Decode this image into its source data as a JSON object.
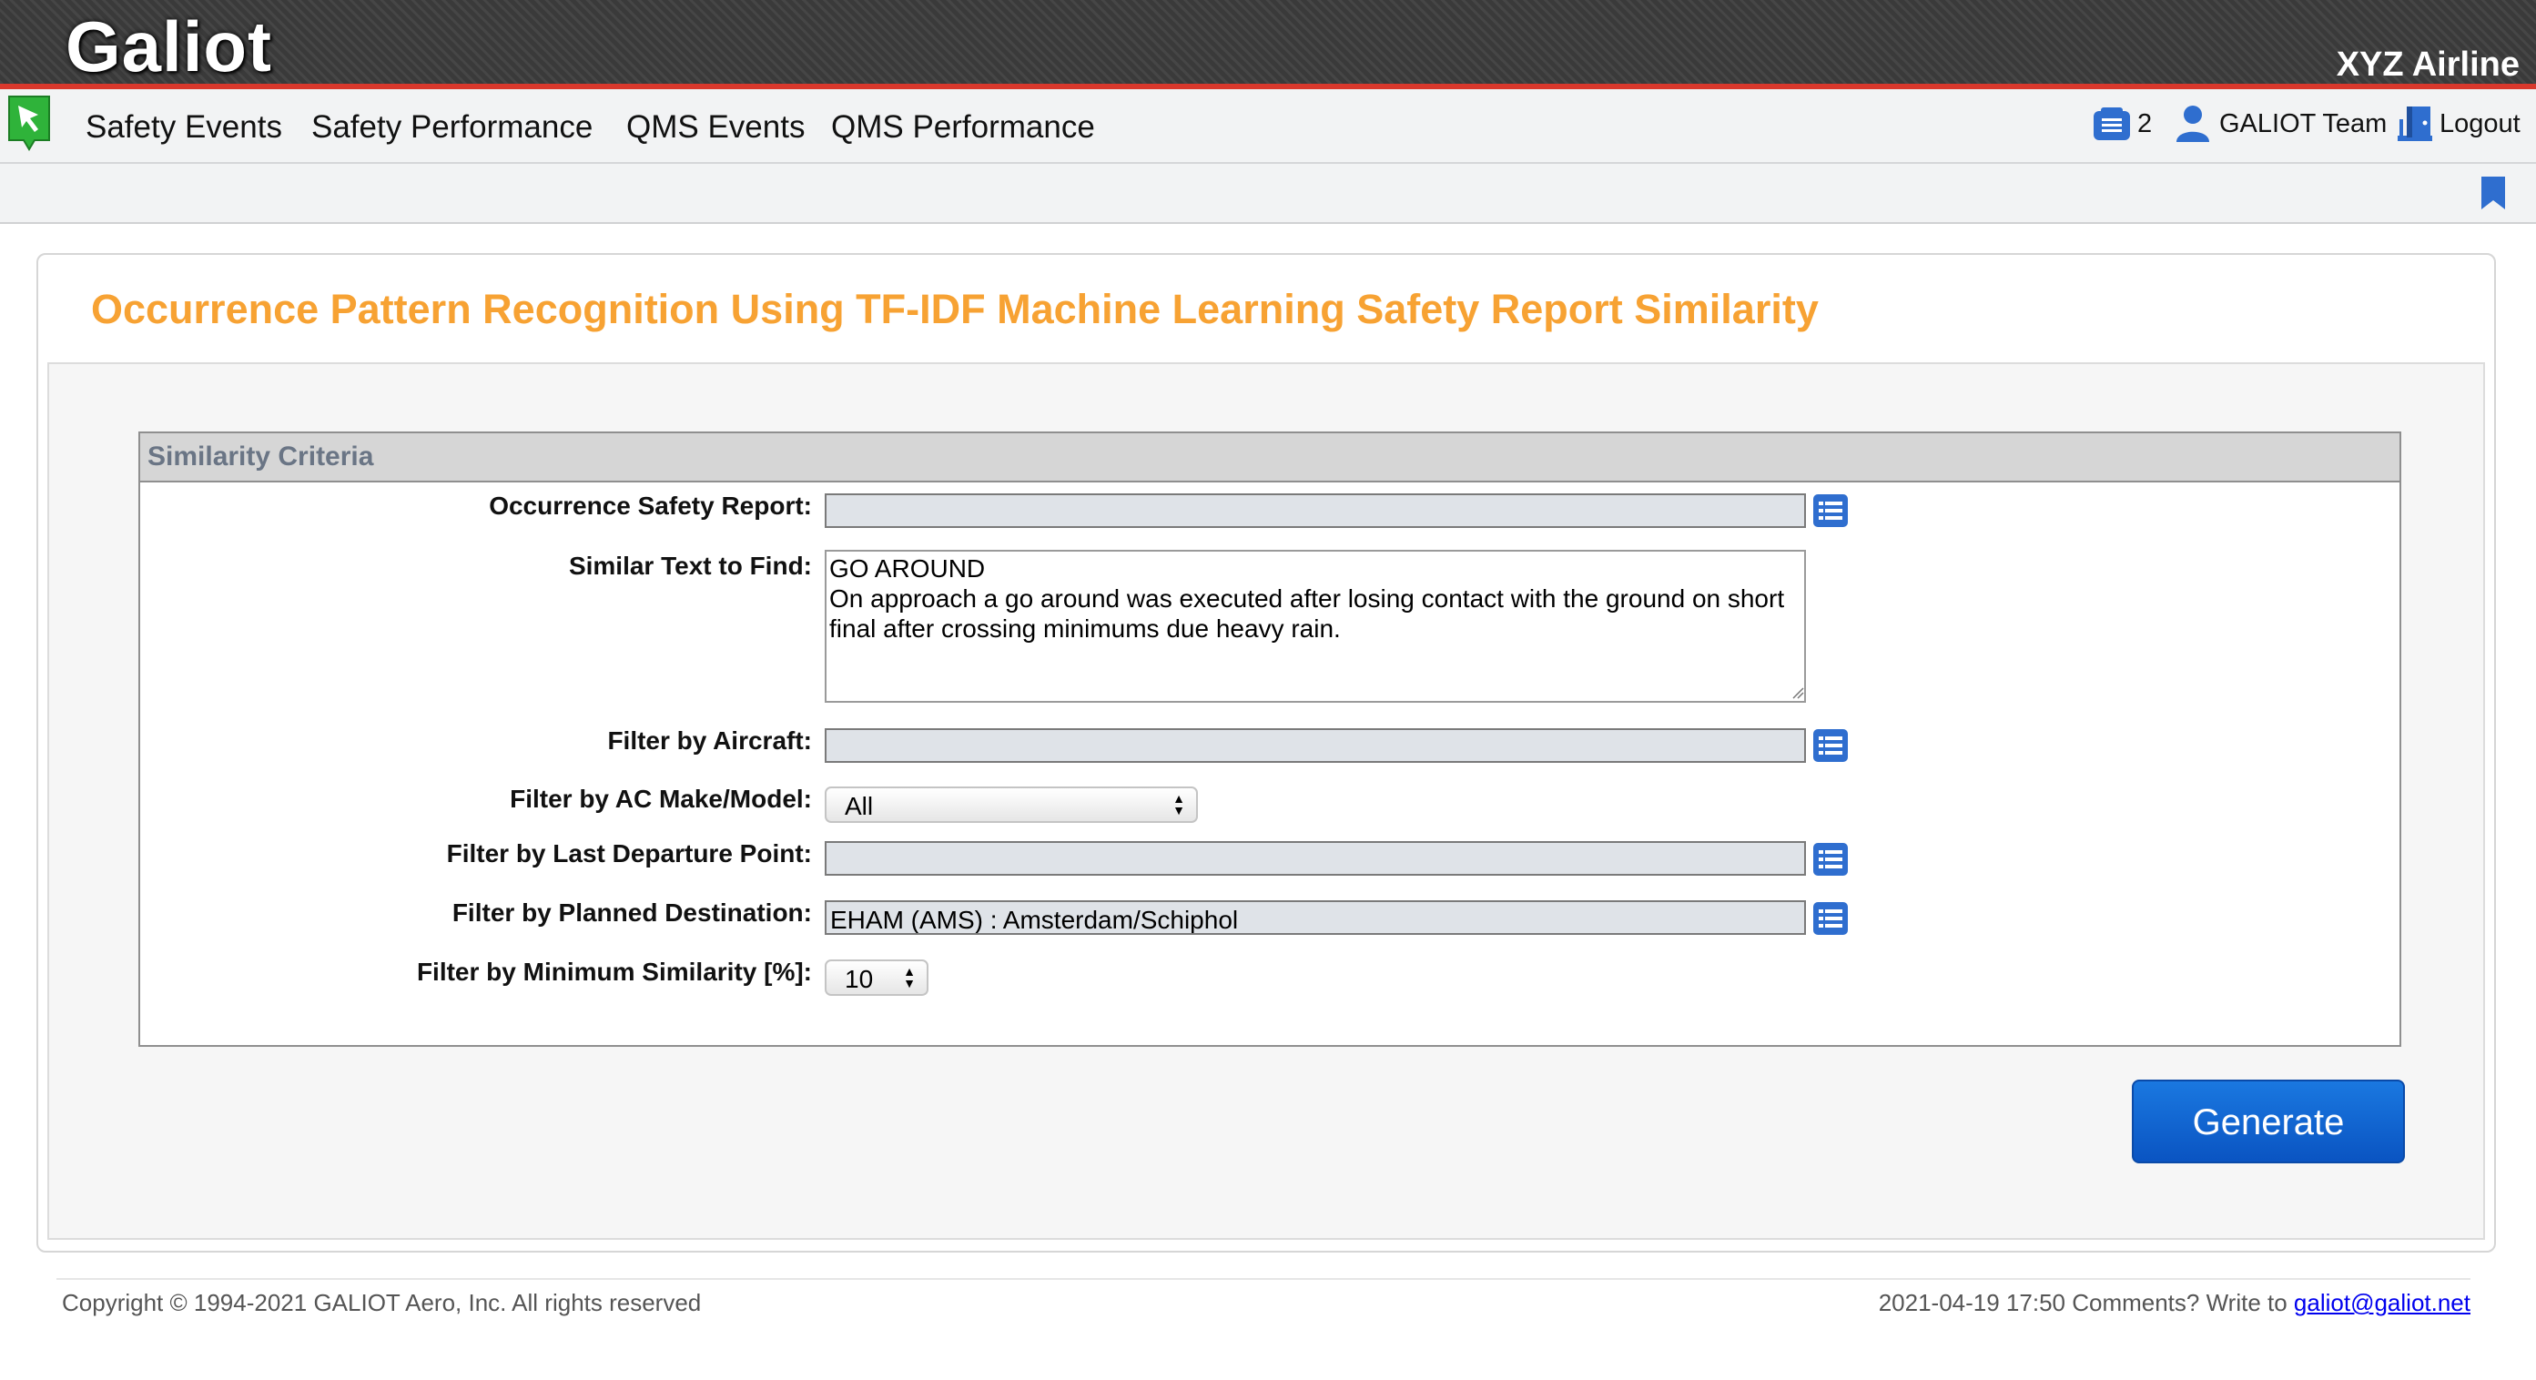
{
  "header": {
    "logo_text": "Galiot",
    "company": "XYZ Airline"
  },
  "nav": {
    "items": [
      "Safety Events",
      "Safety Performance",
      "QMS Events",
      "QMS Performance"
    ],
    "notifications_count": "2",
    "user": "GALIOT Team",
    "logout": "Logout"
  },
  "page": {
    "title": "Occurrence Pattern Recognition Using TF-IDF Machine Learning Safety Report Similarity"
  },
  "criteria": {
    "section_title": "Similarity Criteria",
    "occurrence_report": {
      "label": "Occurrence Safety Report:",
      "value": ""
    },
    "similar_text": {
      "label": "Similar Text to Find:",
      "value": "GO AROUND\nOn approach a go around was executed after losing contact with the ground on short final after crossing minimums due heavy rain."
    },
    "aircraft": {
      "label": "Filter by Aircraft:",
      "value": ""
    },
    "make_model": {
      "label": "Filter by AC Make/Model:",
      "value": "All"
    },
    "departure": {
      "label": "Filter by Last Departure Point:",
      "value": ""
    },
    "destination": {
      "label": "Filter by Planned Destination:",
      "value": "EHAM (AMS) : Amsterdam/Schiphol"
    },
    "min_similarity": {
      "label": "Filter by Minimum Similarity [%]:",
      "value": "10"
    }
  },
  "actions": {
    "generate": "Generate"
  },
  "footer": {
    "copyright": "Copyright © 1994-2021 GALIOT Aero, Inc. All rights reserved",
    "timestamp_comment": "2021-04-19 17:50 Comments? Write to",
    "email": "galiot@galiot.net"
  },
  "colors": {
    "accent_title": "#f7a233",
    "header_rule": "#d9382c",
    "button_blue": "#0a54c2",
    "list_icon_blue": "#2f6ecf"
  }
}
